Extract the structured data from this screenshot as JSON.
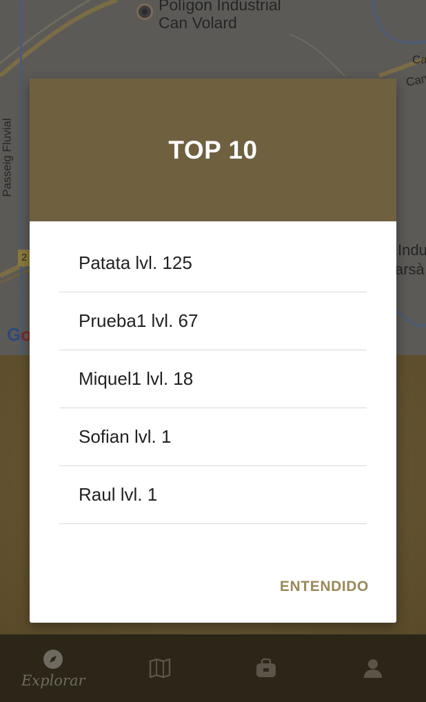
{
  "map": {
    "labels": {
      "poligon": "Polígon Industrial",
      "can_volard": "Can Volard",
      "passeig": "Passeig Fluvial",
      "can_a": "Ca",
      "can_b": "Can",
      "indu": "Indu",
      "arsa": "arsà",
      "road_badge": "2"
    },
    "google_logo": {
      "g1": "G",
      "g2": "o"
    }
  },
  "dialog": {
    "title": "TOP 10",
    "entries": [
      {
        "text": "Patata lvl. 125"
      },
      {
        "text": "Prueba1 lvl. 67"
      },
      {
        "text": "Miquel1 lvl. 18"
      },
      {
        "text": "Sofian lvl. 1"
      },
      {
        "text": "Raul lvl. 1"
      }
    ],
    "confirm_label": "ENTENDIDO",
    "header_color": "#6f6140",
    "accent_color": "#9a8858"
  },
  "bottom_nav": {
    "items": [
      {
        "icon": "compass-icon",
        "label": "Explorar",
        "active": true
      },
      {
        "icon": "map-icon",
        "label": "",
        "active": false
      },
      {
        "icon": "backpack-icon",
        "label": "",
        "active": false
      },
      {
        "icon": "person-icon",
        "label": "",
        "active": false
      }
    ]
  }
}
